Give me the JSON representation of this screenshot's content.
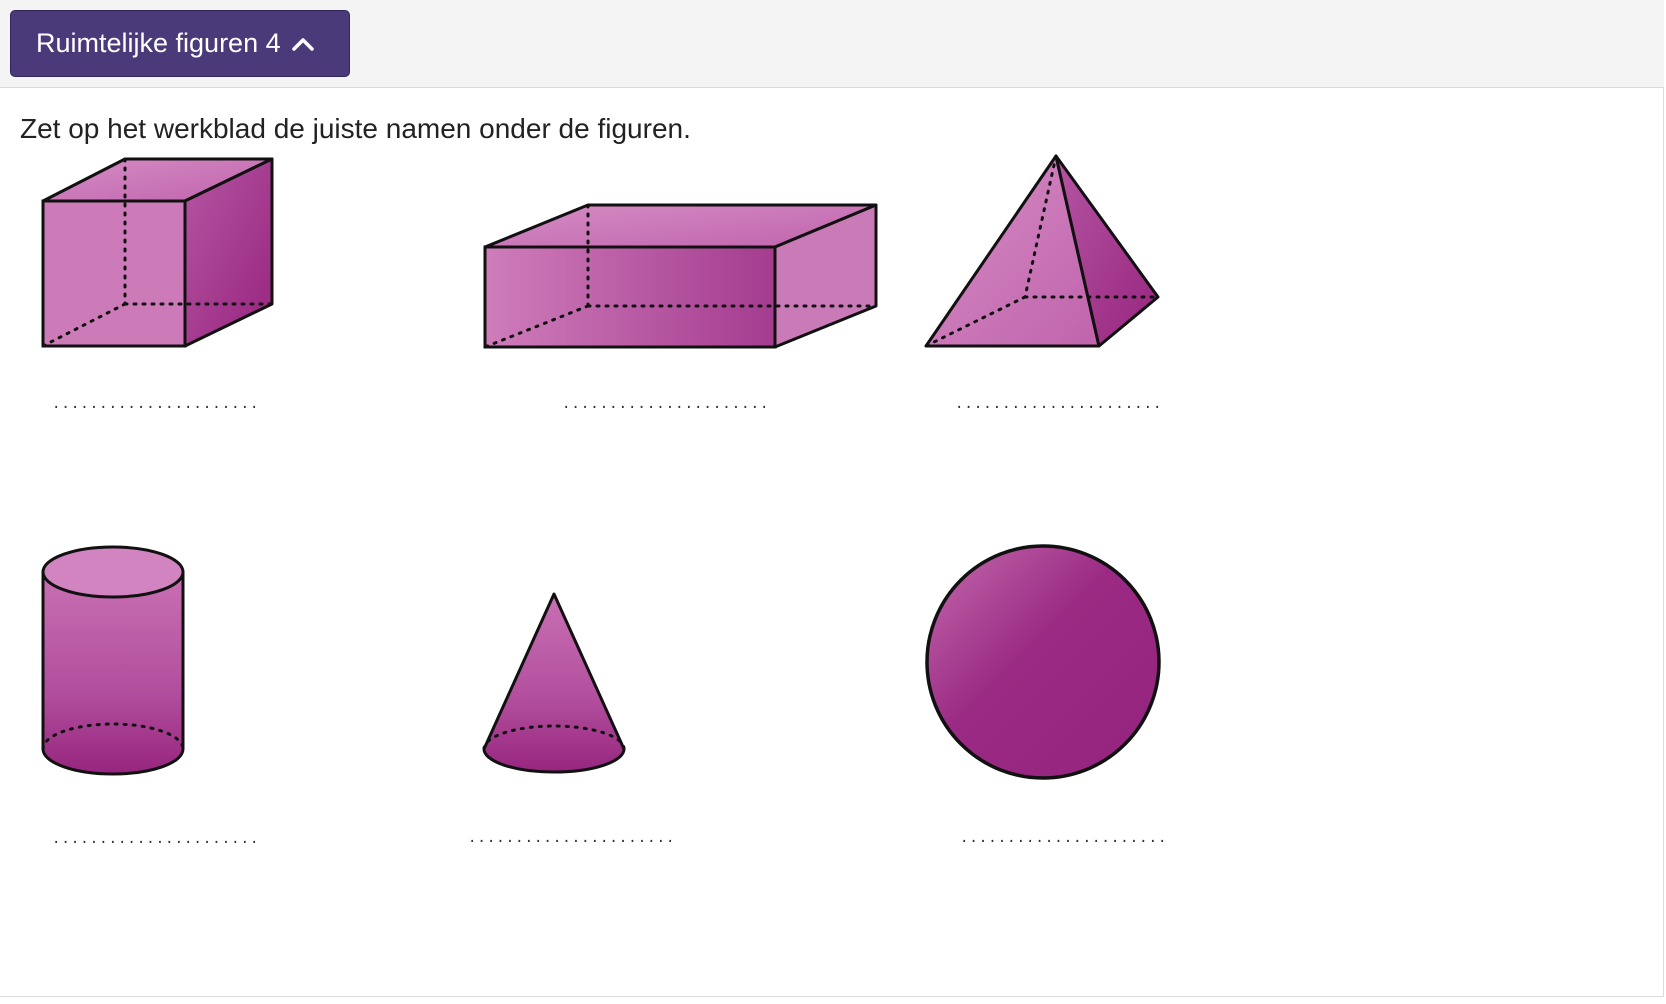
{
  "header": {
    "title": "Ruimtelijke figuren 4",
    "toggle_icon": "chevron-up-icon"
  },
  "instruction": "Zet op het werkblad de juiste namen onder de figuren.",
  "colors": {
    "button": "#4a3a7a",
    "figure_light": "#cc77b8",
    "figure_dark": "#97257f"
  },
  "figures": [
    {
      "shape": "cube",
      "answer": "......................"
    },
    {
      "shape": "cuboid",
      "answer": "......................"
    },
    {
      "shape": "square-pyramid",
      "answer": "......................"
    },
    {
      "shape": "cylinder",
      "answer": "......................"
    },
    {
      "shape": "cone",
      "answer": "......................"
    },
    {
      "shape": "sphere",
      "answer": "......................"
    }
  ]
}
